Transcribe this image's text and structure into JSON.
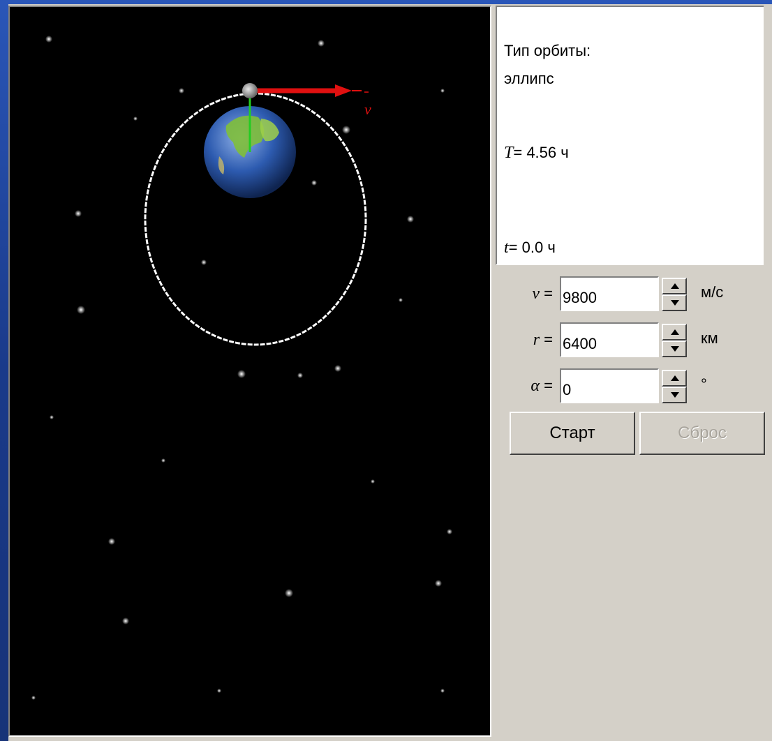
{
  "info": {
    "orbit_type_label": "Тип орбиты:",
    "orbit_type_value": "эллипс",
    "period_symbol": "T",
    "period_value": "= 4.56 ч",
    "time_symbol": "t",
    "time_value": "= 0.0 ч"
  },
  "scene": {
    "velocity_vector_label": "v"
  },
  "controls": {
    "velocity": {
      "symbol": "v",
      "eq": " =",
      "value": "9800",
      "unit": "м/с"
    },
    "radius": {
      "symbol": "r",
      "eq": " =",
      "value": "6400",
      "unit": "км"
    },
    "angle": {
      "symbol": "α",
      "eq": " =",
      "value": "0",
      "unit": "°"
    }
  },
  "buttons": {
    "start": "Старт",
    "reset": "Сброс"
  },
  "colors": {
    "space": "#000000",
    "panel": "#d4d0c8",
    "velocity_arrow": "#e01010",
    "radius_line": "#22cc22",
    "orbit": "#ffffff"
  }
}
